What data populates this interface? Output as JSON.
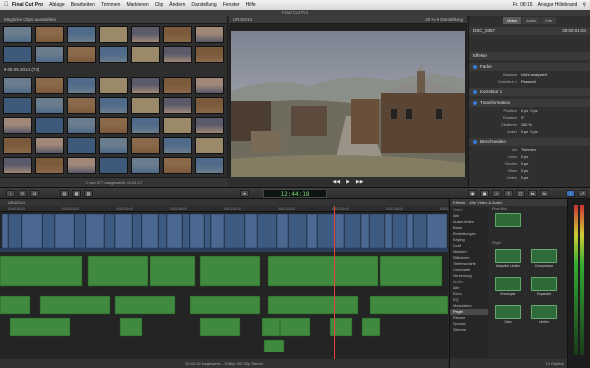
{
  "menubar": {
    "app": "Final Cut Pro",
    "items": [
      "Ablage",
      "Bearbeiten",
      "Trimmen",
      "Markieren",
      "Clip",
      "Ändern",
      "Darstellung",
      "Fenster",
      "Hilfe"
    ],
    "time": "Fr. 08:15",
    "user": "Ansgar Hillebrand"
  },
  "window_title": "Final Cut Pro",
  "browser": {
    "title": "Mögliche Clips auswählen",
    "group_label": "05.05.2014",
    "group_count": "(73)",
    "footer": "1 von 377 ausgewählt, 11:01:17"
  },
  "viewer": {
    "title": "UR42014",
    "zoom": "40 %",
    "view_label": "Darstellung"
  },
  "inspector": {
    "tabs": [
      "Video",
      "Audio",
      "Info"
    ],
    "clip_name": "DSC_0357",
    "clip_time": "00:00:01:04",
    "sections": [
      {
        "name": "Effekte"
      },
      {
        "name": "Farbe"
      },
      {
        "name": "Korrektur 1"
      },
      {
        "name": "Transformation"
      },
      {
        "name": "Beschneiden"
      }
    ],
    "color_rows": [
      {
        "label": "Balance",
        "value": "Nicht analysiert"
      },
      {
        "label": "Korrektur 1",
        "value": "Passend"
      }
    ],
    "transform_rows": [
      {
        "label": "Position",
        "x": "0 px",
        "y": "0 px"
      },
      {
        "label": "Rotation",
        "x": "0°",
        "y": ""
      },
      {
        "label": "Skalieren",
        "x": "100 %",
        "y": ""
      },
      {
        "label": "Anker",
        "x": "0 px",
        "y": "0 px"
      }
    ],
    "crop_rows": [
      {
        "label": "Art",
        "value": "Trimmen"
      },
      {
        "label": "Links",
        "value": "0 px"
      },
      {
        "label": "Rechts",
        "value": "0 px"
      },
      {
        "label": "Oben",
        "value": "0 px"
      },
      {
        "label": "Unten",
        "value": "0 px"
      }
    ]
  },
  "toolbar": {
    "timecode": "12:44:18"
  },
  "timeline": {
    "project": "UR42014",
    "ruler": [
      "00:00:00:00",
      "00:00:15:00",
      "00:00:30:00",
      "00:00:45:00",
      "00:01:00:00",
      "00:01:15:00",
      "00:01:30:00",
      "00:01:45:00",
      "00:02:00:00"
    ],
    "status": "10:40:12 insgesamt – 1080p HD 25p Stereo"
  },
  "effects": {
    "title": "Effekte",
    "filter": "Alle Video & Audio",
    "selected_preview": "Pixel Bild",
    "categories": [
      {
        "label": "Video",
        "header": true
      },
      {
        "label": "Alle"
      },
      {
        "label": "Ausleuchten"
      },
      {
        "label": "Basis"
      },
      {
        "label": "Einstellungen"
      },
      {
        "label": "Keying"
      },
      {
        "label": "Licht"
      },
      {
        "label": "Markiert"
      },
      {
        "label": "Stilisieren"
      },
      {
        "label": "Tiefenschärfe"
      },
      {
        "label": "Unscharfe"
      },
      {
        "label": "Verzerrung"
      },
      {
        "label": "Audio",
        "header": true
      },
      {
        "label": "Alle"
      },
      {
        "label": "Echo"
      },
      {
        "label": "EQ"
      },
      {
        "label": "Modulation"
      },
      {
        "label": "Pegel",
        "selected": true
      },
      {
        "label": "Räume"
      },
      {
        "label": "Spezial"
      },
      {
        "label": "Stimme"
      }
    ],
    "section": "Pegel",
    "items": [
      {
        "label": "Adaptive Limiter"
      },
      {
        "label": "Compressor"
      },
      {
        "label": "Enveloper"
      },
      {
        "label": "Expander"
      },
      {
        "label": "Gain"
      },
      {
        "label": "Limiter"
      }
    ],
    "count": "10 Objekte"
  }
}
